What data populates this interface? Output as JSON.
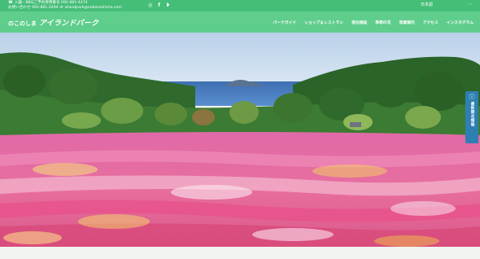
{
  "topbar": {
    "contact_line1": "入園・BBQご予約専用番号 092-881-4474",
    "contact_line2": "お問い合わせ 092-881-2494",
    "contact_email": "islandpark@nokonoshima.com",
    "social": [
      "instagram-icon",
      "facebook-icon",
      "twitter-icon"
    ],
    "language": "日本語"
  },
  "header": {
    "logo_small": "のこのしま",
    "logo_big": "アイランドパーク"
  },
  "nav": {
    "items": [
      "パークガイド",
      "ショップ＆レストラン",
      "宿泊施設",
      "季節の花",
      "営業案内",
      "アクセス",
      "インスタグラム"
    ]
  },
  "side_tab": {
    "label": "最新開花情報",
    "icon": "info-icon"
  },
  "colors": {
    "topbar": "#45be78",
    "nav": "#5fcd8c",
    "side_tab": "#2e7fb2"
  }
}
